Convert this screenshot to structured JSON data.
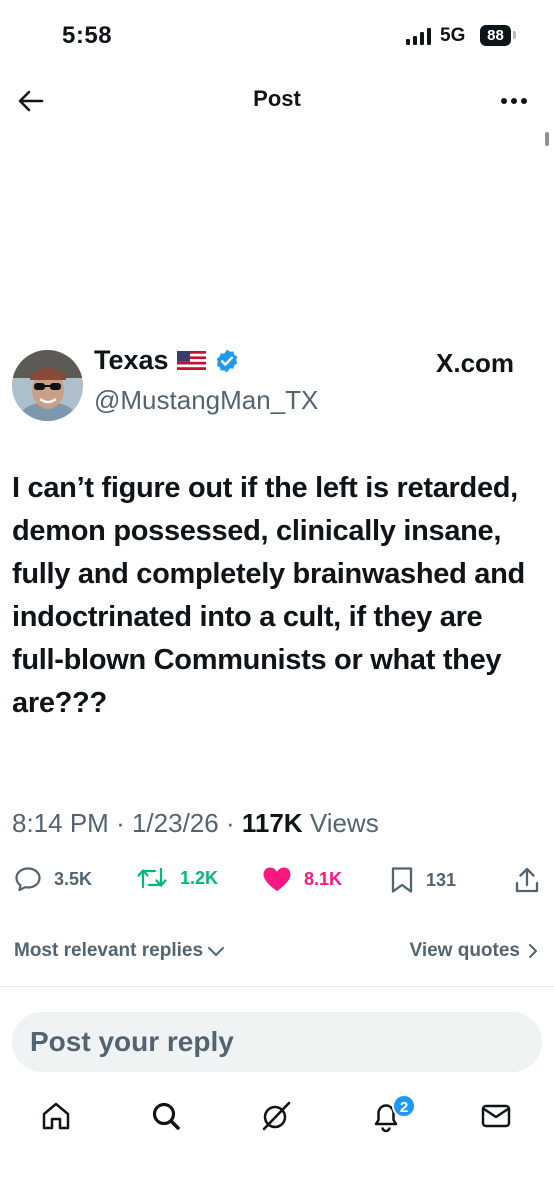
{
  "status_bar": {
    "time": "5:58",
    "network": "5G",
    "battery": "88"
  },
  "header": {
    "title": "Post"
  },
  "author": {
    "name": "Texas",
    "handle": "@MustangMan_TX",
    "source": "X.com"
  },
  "post": {
    "text": "I can’t figure out if the left is retarded, demon possessed, clinically insane, fully and completely brainwashed and indoctrinated into a cult, if they are full-blown Communists or what they are???",
    "time": "8:14 PM",
    "date": "1/23/26",
    "separator": "·",
    "views": "117K",
    "views_label": "Views"
  },
  "actions": {
    "replies": "3.5K",
    "reposts": "1.2K",
    "likes": "8.1K",
    "bookmarks": "131"
  },
  "colors": {
    "repost": "#00ba7c",
    "like": "#f91880",
    "accent": "#1d9bf0",
    "muted": "#536471"
  },
  "replies_nav": {
    "sort_label": "Most relevant replies",
    "quotes_label": "View quotes"
  },
  "reply_box": {
    "placeholder": "Post your reply"
  },
  "bottom_nav": {
    "items": [
      "home-icon",
      "search-icon",
      "grok-icon",
      "notifications-icon",
      "messages-icon"
    ],
    "notification_badge": "2"
  }
}
